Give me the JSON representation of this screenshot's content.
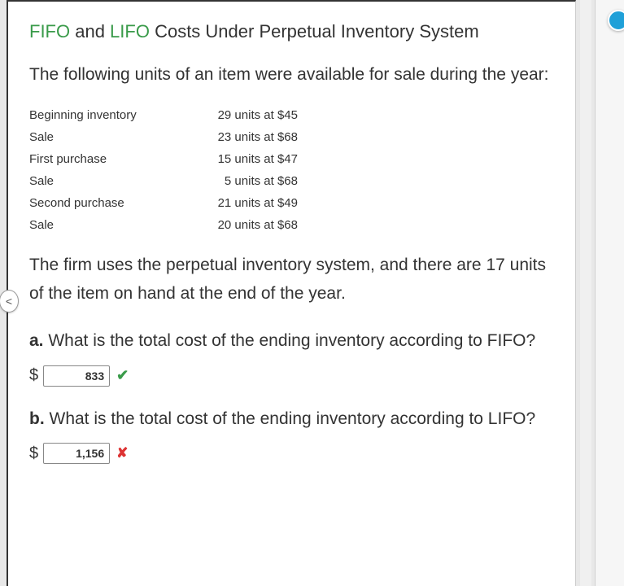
{
  "title": {
    "accent1": "FIFO",
    "mid1": " and ",
    "accent2": "LIFO",
    "rest": " Costs Under Perpetual Inventory System"
  },
  "intro": "The following units of an item were available for sale during the year:",
  "transactions": [
    {
      "label": "Beginning inventory",
      "value": "29 units at $45"
    },
    {
      "label": "Sale",
      "value": "23 units at $68"
    },
    {
      "label": "First purchase",
      "value": "15 units at $47"
    },
    {
      "label": "Sale",
      "value": "5 units at $68"
    },
    {
      "label": "Second purchase",
      "value": "21 units at $49"
    },
    {
      "label": "Sale",
      "value": "20 units at $68"
    }
  ],
  "mid_text": "The firm uses the perpetual inventory system, and there are 17 units of the item on hand at the end of the year.",
  "qa": {
    "a": {
      "label": "a.",
      "text": "  What is the total cost of the ending inventory according to FIFO?",
      "currency": "$",
      "value": "833",
      "status": "correct"
    },
    "b": {
      "label": "b.",
      "text": "  What is the total cost of the ending inventory according to LIFO?",
      "currency": "$",
      "value": "1,156",
      "status": "incorrect"
    }
  },
  "icons": {
    "check": "✔",
    "cross": "✘",
    "nav_prev": "<"
  }
}
